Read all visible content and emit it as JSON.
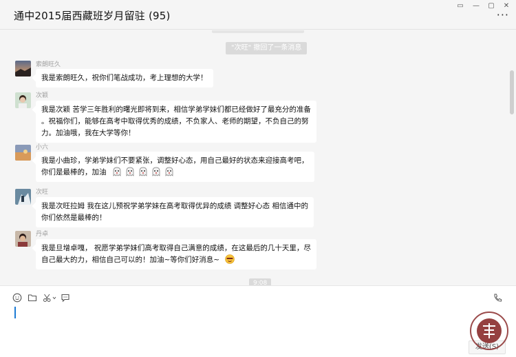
{
  "window": {
    "title": "通中2015届西藏班岁月留驻 (95)",
    "controls": {
      "pin": "▭",
      "minimize": "—",
      "maximize": "▢",
      "close": "✕"
    },
    "more_label": "···"
  },
  "chat": {
    "system_message": "\"次旺\" 撤回了一条消息",
    "time_chip": "9:08",
    "messages": [
      {
        "sender": "索朗旺久",
        "lines": [
          "我是索朗旺久，祝你们笔战成功，考上理想的大学！"
        ]
      },
      {
        "sender": "次颖",
        "lines": [
          "我是次颖 苦学三年胜利的曙光即将到来，相信学弟学妹们都已经做好了最充分的准备",
          "。祝福你们，能够在高考中取得优秀的成绩，不负家人、老师的期望，不负自己的努",
          "力。加油哦，我在大学等你！"
        ]
      },
      {
        "sender": "小六",
        "lines": [
          "我是小曲珍，学弟学妹们不要紧张，调整好心态，用自己最好的状态来迎接高考吧，",
          "你们是最棒的，加油"
        ],
        "emoji_count": 5
      },
      {
        "sender": "次旺",
        "lines": [
          "我是次旺拉姆 我在这儿预祝学弟学妹在高考取得优异的成绩 调整好心态 相信通中的",
          "你们依然是最棒的！"
        ]
      },
      {
        "sender": "丹卓",
        "lines": [
          "我是旦增卓嘎， 祝愿学弟学妹们高考取得自己满意的成绩，在这最后的几十天里，尽",
          "自己最大的力，相信自己可以的！加油~等你们好消息~"
        ]
      }
    ]
  },
  "input": {
    "send_label": "发送(S)",
    "tools": [
      "emoji-icon",
      "folder-icon",
      "scissors-icon",
      "chat-bubble-icon"
    ],
    "call_icon": "phone-call-icon"
  },
  "colors": {
    "bubble": "#ffffff",
    "background": "#f5f5f5",
    "caret": "#1a7ad4",
    "seal": "#8a2b2b"
  }
}
